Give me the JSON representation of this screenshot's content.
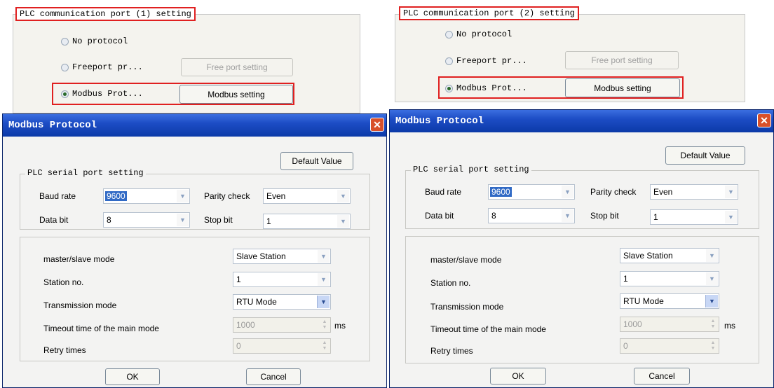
{
  "panels": [
    {
      "port_title": "PLC communication port (1) setting",
      "radios": [
        {
          "label": "No protocol",
          "checked": false
        },
        {
          "label": "Freeport pr...",
          "checked": false
        },
        {
          "label": "Modbus Prot...",
          "checked": true
        }
      ],
      "free_port_button": "Free port setting",
      "modbus_button": "Modbus setting",
      "dialog": {
        "title": "Modbus Protocol",
        "close_glyph": "✕",
        "default_value_button": "Default Value",
        "serial_group_title": "PLC serial port setting",
        "baud_rate_label": "Baud rate",
        "baud_rate_value": "9600",
        "parity_label": "Parity check",
        "parity_value": "Even",
        "data_bit_label": "Data bit",
        "data_bit_value": "8",
        "stop_bit_label": "Stop bit",
        "stop_bit_value": "1",
        "mode_label": "master/slave mode",
        "mode_value": "Slave Station",
        "station_label": "Station no.",
        "station_value": "1",
        "transmission_label": "Transmission mode",
        "transmission_value": "RTU Mode",
        "timeout_label": "Timeout time of the main mode",
        "timeout_value": "1000",
        "timeout_unit": "ms",
        "retry_label": "Retry times",
        "retry_value": "0",
        "ok_button": "OK",
        "cancel_button": "Cancel"
      }
    },
    {
      "port_title": "PLC communication port (2) setting",
      "radios": [
        {
          "label": "No protocol",
          "checked": false
        },
        {
          "label": "Freeport pr...",
          "checked": false
        },
        {
          "label": "Modbus Prot...",
          "checked": true
        }
      ],
      "free_port_button": "Free port setting",
      "modbus_button": "Modbus setting",
      "dialog": {
        "title": "Modbus Protocol",
        "close_glyph": "✕",
        "default_value_button": "Default Value",
        "serial_group_title": "PLC serial port setting",
        "baud_rate_label": "Baud rate",
        "baud_rate_value": "9600",
        "parity_label": "Parity check",
        "parity_value": "Even",
        "data_bit_label": "Data bit",
        "data_bit_value": "8",
        "stop_bit_label": "Stop bit",
        "stop_bit_value": "1",
        "mode_label": "master/slave mode",
        "mode_value": "Slave Station",
        "station_label": "Station no.",
        "station_value": "1",
        "transmission_label": "Transmission mode",
        "transmission_value": "RTU Mode",
        "timeout_label": "Timeout time of the main mode",
        "timeout_value": "1000",
        "timeout_unit": "ms",
        "retry_label": "Retry times",
        "retry_value": "0",
        "ok_button": "OK",
        "cancel_button": "Cancel"
      }
    }
  ],
  "colors": {
    "highlight": "#e02020",
    "titlebar": "#1d4dc5",
    "close": "#d8502a",
    "selection": "#316ac5"
  },
  "icons": {
    "close": "close-icon",
    "dropdown": "chevron-down-icon",
    "spinner": "spinner-arrows-icon",
    "radio": "radio-button"
  }
}
